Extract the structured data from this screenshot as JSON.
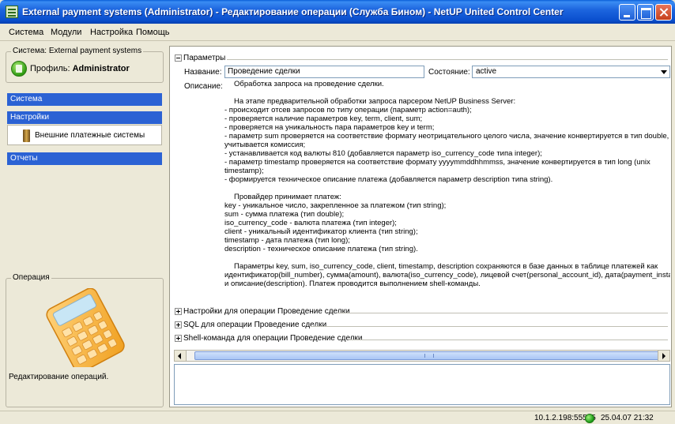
{
  "window": {
    "title": "External payment systems (Administrator) - Редактирование операции (Служба Бином) - NetUP United Control Center"
  },
  "menu": [
    "Система",
    "Модули",
    "Настройка",
    "Помощь"
  ],
  "left_panel": {
    "system_group_title": "Система: External payment systems",
    "profile_prefix": "Профиль:",
    "profile_name": "Administrator",
    "nav": {
      "system": "Система",
      "settings": "Настройки",
      "settings_item": "Внешние платежные системы",
      "reports": "Отчеты"
    },
    "operation_group_title": "Операция",
    "operation_caption": "Редактирование операций."
  },
  "params": {
    "section_title": "Параметры",
    "name_label": "Название:",
    "name_value": "Проведение сделки",
    "state_label": "Состояние:",
    "state_value": "active",
    "desc_label": "Описание:",
    "description": {
      "l1": "Обработка запроса на проведение сделки.",
      "l2": "На этапе предварительной обработки запроса парсером NetUP Business Server:",
      "l3": "- происходит отсев запросов по типу операции (параметр action=auth);",
      "l4": "- проверяется наличие параметров key, term, client, sum;",
      "l5": "- проверяется на уникальность пара параметров key и term;",
      "l6": "- параметр sum проверяется на соответствие формату неотрицательного целого числа, значение конвертируется в тип double,",
      "l7": "учитывается комиссия;",
      "l8": "- устанавливается код валюты 810 (добавляется параметр iso_currency_code типа integer);",
      "l9": "- параметр timestamp проверяется на соответствие формату yyyymmddhhmmss, значение конвертируется в тип long (unix",
      "l10": "timestamp);",
      "l11": "- формируется техническое описание платежа (добавляется параметр description типа string).",
      "l12": "Провайдер принимает платеж:",
      "l13": "key - уникальное число, закрепленное за платежом (тип string);",
      "l14": "sum - сумма платежа (тип double);",
      "l15": "iso_currency_code - валюта платежа (тип integer);",
      "l16": "client - уникальный идентификатор клиента (тип string);",
      "l17": "timestamp - дата платежа (тип long);",
      "l18": "description - техническое описание платежа (тип string).",
      "l19": "Параметры key, sum, iso_currency_code, client, timestamp, description сохраняются в базе данных в таблице платежей как",
      "l20": "идентификатор(bill_number), сумма(amount), валюта(iso_currency_code), лицевой счет(personal_account_id), дата(payment_instant)",
      "l21": "и описание(description). Платеж проводится выполнением shell-команды."
    }
  },
  "sections": {
    "settings": "Настройки для операции Проведение сделки",
    "sql": "SQL для операции Проведение сделки",
    "shell": "Shell-команда для операции Проведение сделки"
  },
  "status": {
    "address": "10.1.2.198:55555",
    "datetime": "25.04.07 21:32"
  },
  "colors": {
    "titlebar": "#0a4fce",
    "nav_selected": "#2b62d4",
    "status_ok": "#1a9a16"
  }
}
